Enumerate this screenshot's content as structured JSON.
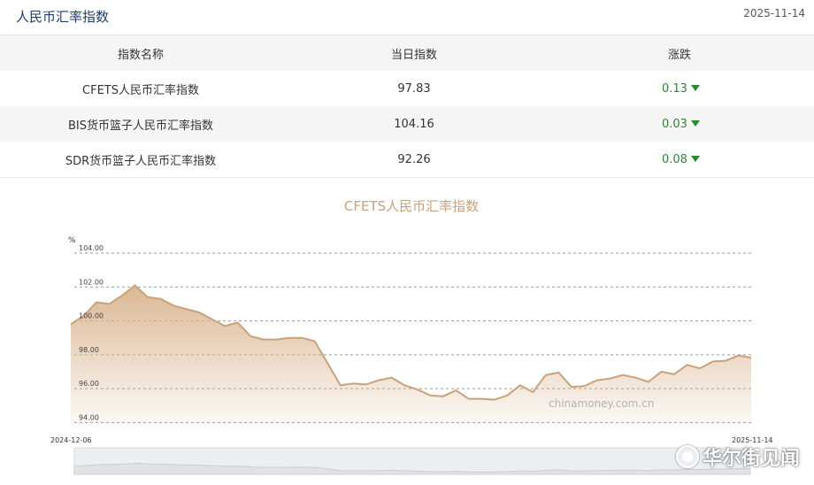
{
  "header": {
    "title": "人民币汇率指数",
    "date": "2025-11-14"
  },
  "table": {
    "columns": [
      "指数名称",
      "当日指数",
      "涨跌"
    ],
    "rows": [
      {
        "name": "CFETS人民币汇率指数",
        "value": "97.83",
        "change": "0.13"
      },
      {
        "name": "BIS货币篮子人民币汇率指数",
        "value": "104.16",
        "change": "0.03"
      },
      {
        "name": "SDR货币篮子人民币汇率指数",
        "value": "92.26",
        "change": "0.08"
      }
    ]
  },
  "watermark": "华尔街见闻",
  "chart_data": {
    "type": "area",
    "title": "CFETS人民币汇率指数",
    "ylabel": "%",
    "ylim": [
      93.5,
      104.0
    ],
    "yticks": [
      "104.00",
      "102.00",
      "100.00",
      "98.00",
      "96.00",
      "94.00"
    ],
    "ytick_values": [
      104,
      102,
      100,
      98,
      96,
      94
    ],
    "x_start_label": "2024-12-06",
    "x_end_label": "2025-11-14",
    "source": "chinamoney.com.cn",
    "grid": true,
    "line_color": "#c9a27a",
    "series": [
      {
        "values": [
          99.8,
          100.3,
          101.1,
          101.0,
          101.5,
          102.1,
          101.4,
          101.3,
          100.9,
          100.7,
          100.5,
          100.1,
          99.7,
          99.9,
          99.1,
          98.9,
          98.9,
          99.0,
          99.0,
          98.8,
          97.5,
          96.2,
          96.3,
          96.25,
          96.5,
          96.65,
          96.2,
          95.95,
          95.6,
          95.55,
          95.9,
          95.4,
          95.4,
          95.35,
          95.6,
          96.2,
          95.8,
          96.8,
          96.95,
          96.1,
          96.15,
          96.5,
          96.6,
          96.8,
          96.65,
          96.4,
          97.0,
          96.85,
          97.4,
          97.2,
          97.6,
          97.65,
          97.95,
          97.83
        ]
      }
    ]
  }
}
